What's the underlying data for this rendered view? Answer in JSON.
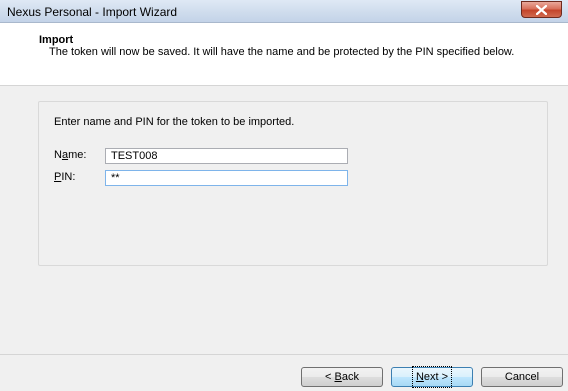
{
  "window": {
    "title": "Nexus Personal - Import Wizard"
  },
  "header": {
    "title": "Import",
    "description": "The token will now be saved. It will have the name and be protected by the PIN specified below."
  },
  "form": {
    "instructions": "Enter name and PIN for the token to be imported.",
    "name_label_prefix": "N",
    "name_label_mnemonic": "a",
    "name_label_suffix": "me:",
    "name_value": "TEST008",
    "pin_label_mnemonic": "P",
    "pin_label_suffix": "IN:",
    "pin_value": "**"
  },
  "footer": {
    "back_mnemonic": "B",
    "back_prefix": "< ",
    "back_suffix": "ack",
    "next_mnemonic": "N",
    "next_suffix": "ext >",
    "cancel_label": "Cancel"
  },
  "icons": {
    "close": "close-icon"
  },
  "colors": {
    "close_button": "#c4452b",
    "title_bar": "#cfdced",
    "default_button_border": "#3c7fb1"
  }
}
